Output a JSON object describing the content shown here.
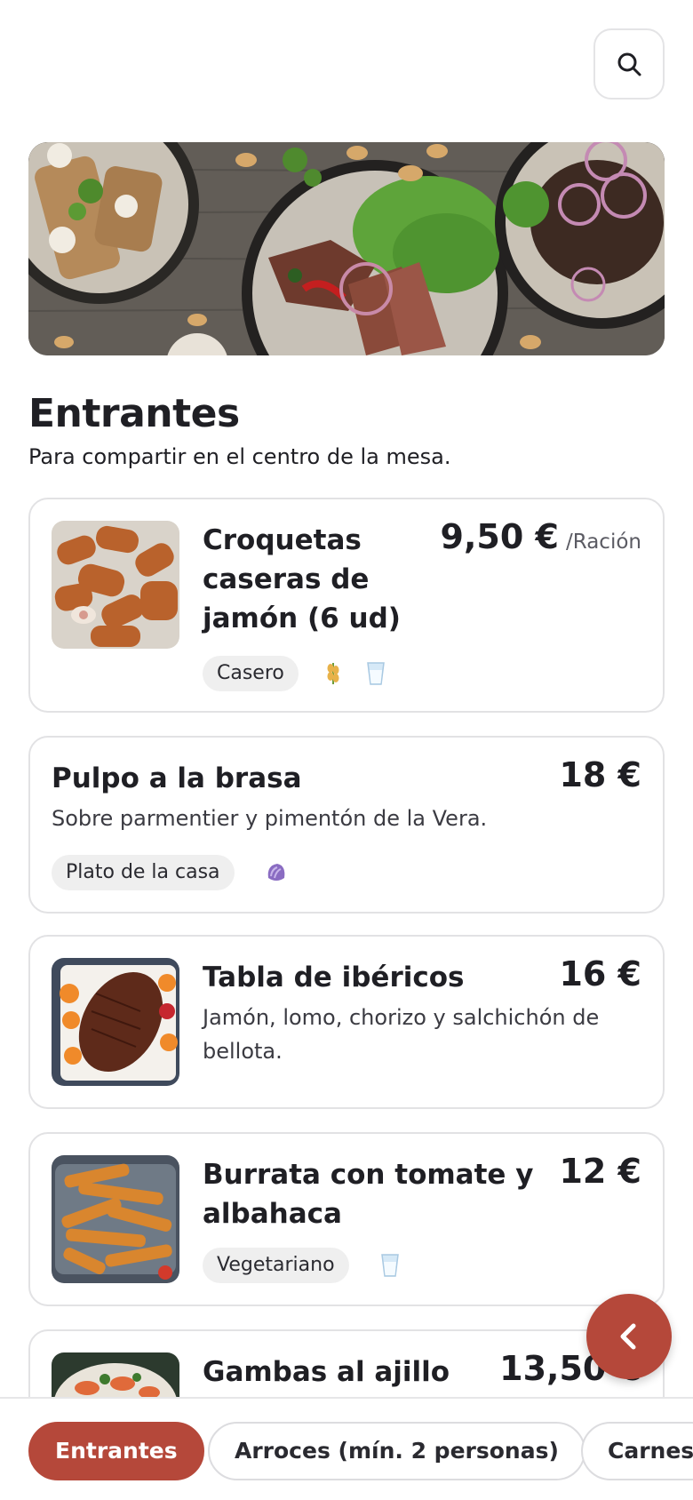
{
  "search": {
    "icon": "search-icon"
  },
  "section": {
    "title": "Entrantes",
    "subtitle": "Para compartir en el centro de la mesa."
  },
  "items": [
    {
      "name": "Croquetas caseras de jamón (6 ud)",
      "price": "9,50 €",
      "unit": "/Ración",
      "tags": [
        "Casero"
      ],
      "allergens": [
        "wheat-icon",
        "milk-icon"
      ]
    },
    {
      "name": "Pulpo a la brasa",
      "price": "18 €",
      "description": "Sobre parmentier y pimentón de la Vera.",
      "tags": [
        "Plato de la casa"
      ],
      "allergens": [
        "mollusc-icon"
      ]
    },
    {
      "name": "Tabla de ibéricos",
      "price": "16 €",
      "description": "Jamón, lomo, chorizo y salchichón de bellota."
    },
    {
      "name": "Burrata con tomate y albahaca",
      "price": "12 €",
      "tags": [
        "Vegetariano"
      ],
      "allergens": [
        "milk-icon"
      ]
    },
    {
      "name": "Gambas al ajillo",
      "price": "13,50 €"
    }
  ],
  "nav": {
    "categories": [
      "Entrantes",
      "Arroces (mín. 2 personas)",
      "Carnes"
    ],
    "active": "Entrantes"
  },
  "colors": {
    "accent": "#b5483a",
    "border": "#e2e2e4",
    "tag_bg": "#efefef"
  }
}
